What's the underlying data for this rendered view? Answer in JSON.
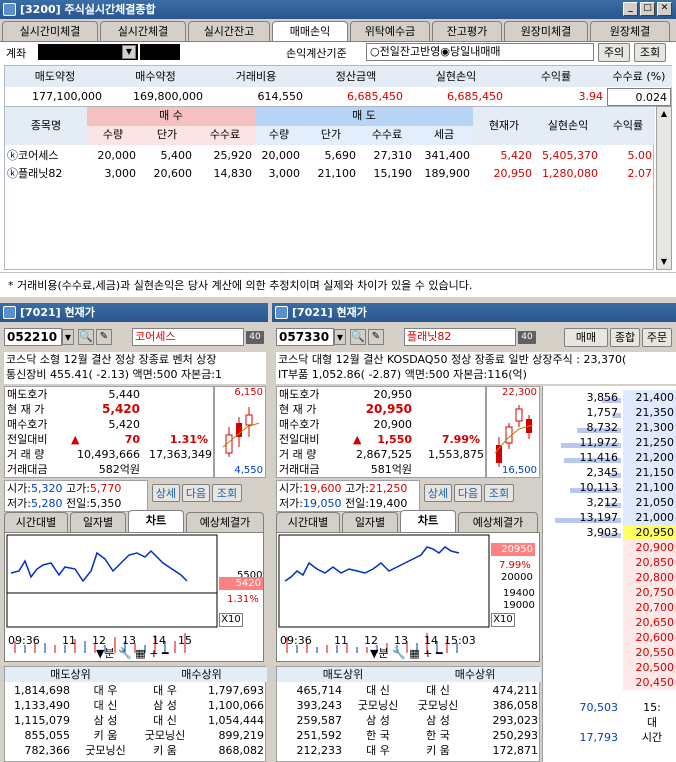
{
  "top_window": {
    "title": "[3200] 주식실시간체결종합",
    "tabs": [
      "실시간미체결",
      "실시간체결",
      "실시간잔고",
      "매매손익",
      "위탁예수금",
      "잔고평가",
      "원장미체결",
      "원장체결"
    ],
    "active_tab": "매매손익",
    "account_label": "계좌",
    "calc_basis_label": "손익계산기준",
    "radio1": "전일잔고반영",
    "radio2": "당일내매매",
    "btn_notice": "주의",
    "btn_query": "조회",
    "summary_headers": [
      "매도약정",
      "매수약정",
      "거래비용",
      "정산금액",
      "실현손익",
      "수익률",
      "수수료 (%)"
    ],
    "summary_values": [
      "177,100,000",
      "169,800,000",
      "614,550",
      "6,685,450",
      "6,685,450",
      "3.94",
      "0.024"
    ],
    "grid_header_top": {
      "name": "종목명",
      "buy": "매 수",
      "sell": "매 도",
      "cur": "현재가",
      "pnl": "실현손익",
      "rate": "수익률"
    },
    "grid_subheaders": [
      "수량",
      "단가",
      "수수료",
      "수량",
      "단가",
      "수수료",
      "세금"
    ],
    "rows": [
      {
        "name": "ⓚ코어세스",
        "bq": "20,000",
        "bp": "5,400",
        "bf": "25,920",
        "sq": "20,000",
        "sp": "5,690",
        "sf": "27,310",
        "tax": "341,400",
        "cur": "5,420",
        "pnl": "5,405,370",
        "rate": "5.00"
      },
      {
        "name": "ⓚ플래닛82",
        "bq": "3,000",
        "bp": "20,600",
        "bf": "14,830",
        "sq": "3,000",
        "sp": "21,100",
        "sf": "15,190",
        "tax": "189,900",
        "cur": "20,950",
        "pnl": "1,280,080",
        "rate": "2.07"
      }
    ],
    "footnote": "* 거래비용(수수료,세금)과 실현손익은 당사 계산에 의한 추정치이며 실제와 차이가 있을 수 있습니다."
  },
  "left": {
    "title": "[7021] 현재가",
    "code": "052210",
    "name": "코어세스",
    "badge": "40",
    "info1": "코스닥 소형 12월 결산 정상 장종료 벤처 상장",
    "info2": "통신장비 455.41( -2.13) 액면:500 자본금:1",
    "quote_labels": [
      "매도호가",
      "현 재 가",
      "매수호가",
      "전일대비",
      "거 래 량",
      "거래대금"
    ],
    "ask": "5,440",
    "price": "5,420",
    "bid": "5,420",
    "diff": "70",
    "diff_pct": "1.31%",
    "vol1": "10,493,666",
    "vol2": "17,363,349",
    "amount": "582억원",
    "mini_hi": "6,150",
    "mini_lo": "4,550",
    "open_lbl": "시가:",
    "open": "5,320",
    "high_lbl": "고가:",
    "high": "5,770",
    "low_lbl": "저가:",
    "low": "5,280",
    "prev_lbl": "전일:",
    "prev": "5,350",
    "btn_detail": "상세",
    "btn_next": "다음",
    "btn_query": "조회",
    "tabs": [
      "시간대별",
      "일자별",
      "차트",
      "예상체결가"
    ],
    "chart_labels": {
      "y1": "5500",
      "price_tag": "5420",
      "pct_tag": "1.31%",
      "x10": "X10",
      "xs": [
        "09:36",
        "11",
        "12",
        "13",
        "14",
        "15"
      ]
    },
    "toolbar": "분",
    "rank_buy_title": "매도상위",
    "rank_sell_title": "매수상위",
    "sell_rank": [
      [
        "1,814,698",
        "대 우"
      ],
      [
        "1,133,490",
        "대 신"
      ],
      [
        "1,115,079",
        "삼 성"
      ],
      [
        "855,055",
        "키 움"
      ],
      [
        "782,366",
        "굿모닝신"
      ]
    ],
    "buy_rank": [
      [
        "대 우",
        "1,797,693"
      ],
      [
        "삼 성",
        "1,100,066"
      ],
      [
        "대 신",
        "1,054,444"
      ],
      [
        "굿모닝신",
        "899,219"
      ],
      [
        "키 움",
        "868,082"
      ]
    ]
  },
  "right": {
    "title": "[7021] 현재가",
    "code": "057330",
    "name": "플래닛82",
    "badge": "40",
    "btn_trade": "매매",
    "btn_comp": "종합",
    "btn_order": "주문",
    "info1": "코스닥 대형 12월 결산 KOSDAQ50 정상 장종료 일반 상장주식 : 23,370(",
    "info2": "IT부품 1,052.86( -2.87) 액면:500 자본금:116(억)",
    "quote_labels": [
      "매도호가",
      "현 재 가",
      "매수호가",
      "전일대비",
      "거 래 량",
      "거래대금"
    ],
    "ask": "20,950",
    "price": "20,950",
    "bid": "20,900",
    "diff": "1,550",
    "diff_pct": "7.99%",
    "vol1": "2,867,525",
    "vol2": "1,553,875",
    "amount": "581억원",
    "mini_hi": "22,300",
    "mini_lo": "16,500",
    "open_lbl": "시가:",
    "open": "19,600",
    "high_lbl": "고가:",
    "high": "21,250",
    "low_lbl": "저가:",
    "low": "19,050",
    "prev_lbl": "전일:",
    "prev": "19,400",
    "btn_detail": "상세",
    "btn_next": "다음",
    "btn_query": "조회",
    "tabs": [
      "시간대별",
      "일자별",
      "차트",
      "예상체결가"
    ],
    "chart_labels": {
      "price_tag": "20950",
      "pct_tag": "7.99%",
      "y1": "20000",
      "y2": "19400",
      "y3": "19000",
      "x10": "X10",
      "xs": [
        "09:36",
        "11",
        "12",
        "13",
        "14",
        "15:03"
      ]
    },
    "toolbar": "분",
    "rank_buy_title": "매도상위",
    "rank_sell_title": "매수상위",
    "sell_rank": [
      [
        "465,714",
        "대 신"
      ],
      [
        "393,243",
        "굿모닝신"
      ],
      [
        "259,587",
        "삼 성"
      ],
      [
        "251,592",
        "한 국"
      ],
      [
        "212,233",
        "대 우"
      ]
    ],
    "buy_rank": [
      [
        "대 신",
        "474,211"
      ],
      [
        "굿모닝신",
        "386,058"
      ],
      [
        "삼 성",
        "293,023"
      ],
      [
        "한 국",
        "250,293"
      ],
      [
        "키 움",
        "172,871"
      ]
    ],
    "ask_qty": [
      "3,856",
      "1,757",
      "8,732",
      "11,972",
      "11,416"
    ],
    "ask_prices": [
      "21,400",
      "21,350",
      "21,300",
      "21,250",
      "21,200"
    ],
    "bid_qty": [
      "2,345",
      "10,113",
      "3,212",
      "13,197",
      "3,903"
    ],
    "mid_prices": [
      "21,150",
      "21,100",
      "21,050",
      "21,000",
      "20,950"
    ],
    "low_prices": [
      "20,900",
      "20,850",
      "20,800",
      "20,750",
      "20,700",
      "20,650",
      "20,600",
      "20,550",
      "20,500",
      "20,450"
    ],
    "bottom_qty": [
      "70,503",
      "17,793"
    ],
    "bottom_right": [
      "15:",
      "대",
      "시간"
    ]
  }
}
